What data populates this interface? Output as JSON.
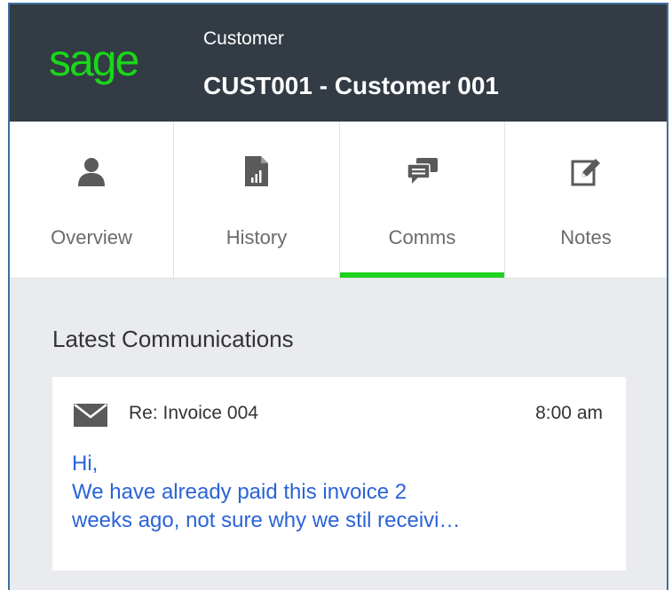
{
  "header": {
    "logo": "sage",
    "entity_type": "Customer",
    "entity_title": "CUST001 - Customer 001"
  },
  "tabs": [
    {
      "label": "Overview",
      "icon": "person-icon",
      "active": false
    },
    {
      "label": "History",
      "icon": "document-chart-icon",
      "active": false
    },
    {
      "label": "Comms",
      "icon": "chat-bubbles-icon",
      "active": true
    },
    {
      "label": "Notes",
      "icon": "edit-note-icon",
      "active": false
    }
  ],
  "colors": {
    "header_bg": "#333b44",
    "brand_green": "#19d619",
    "active_indicator": "#1fd21f",
    "link_blue": "#2a63d8",
    "content_bg": "#e9ebee"
  },
  "communications": {
    "section_title": "Latest Communications",
    "items": [
      {
        "icon": "envelope-icon",
        "subject": "Re: Invoice 004",
        "time": "8:00 am",
        "body_lines": [
          "Hi,",
          "We have already paid this invoice 2",
          "weeks ago, not sure why we stil receivi…"
        ]
      }
    ]
  }
}
